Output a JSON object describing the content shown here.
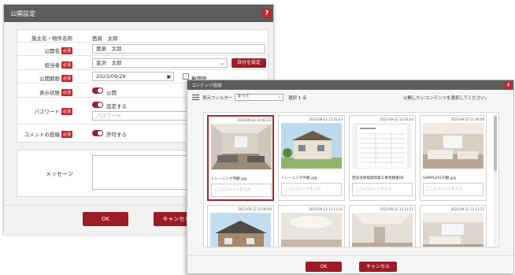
{
  "publish_dialog": {
    "title": "公開設定",
    "help_label": "?",
    "required_badge": "必須",
    "fields": {
      "builder_label": "施主名・物件名称",
      "builder_value": "茜泉　太郎",
      "public_name_label": "公開名",
      "public_name_value": "茜泉　太郎",
      "assignee_label": "担当者",
      "assignee_value": "金沢　太郎",
      "assign_self_button": "自分を設定",
      "period_label": "公開期限",
      "period_value": "2023/09/29",
      "indefinite_label": "無期限",
      "status_label": "表示状態",
      "status_value": "公開",
      "password_label": "パスワード",
      "password_toggle": "設定する",
      "password_placeholder": "パスワード",
      "comment_label": "コメントの投稿",
      "comment_toggle": "許可する",
      "message_label": "メッセージ"
    },
    "ok_button": "OK",
    "cancel_button": "キャンセル"
  },
  "content_dialog": {
    "title": "コンテンツ追加",
    "help_label": "?",
    "filter_label": "表示フィルター",
    "filter_value": "すべて",
    "selected_count": "選択 1 点",
    "instruction": "公開したいコンテンツを選択してください。",
    "comment_placeholder": "ここにコメントを入力",
    "cards": [
      {
        "timestamp": "2023-09-22 11:03:23",
        "filename": "トレーニング内観.jpg"
      },
      {
        "timestamp": "2023-09-22 11:03:23",
        "filename": "トレーニング外観.jpg"
      },
      {
        "timestamp": "2023-09-22 11:03:24",
        "filename": "西泉太郎様邸新築工事見積書06"
      },
      {
        "timestamp": "2023-09-22 11:06:08",
        "filename": "SAMPLE01内観.jpg"
      }
    ],
    "cards_row2": [
      {
        "timestamp": "2023-09-22 11:06:09"
      },
      {
        "timestamp": "2023-09-22 11:11:11"
      },
      {
        "timestamp": "2023-09-22 11:11:11"
      },
      {
        "timestamp": "2023-09-22 11:11:11"
      }
    ],
    "ok_button": "OK",
    "cancel_button": "キャンセル"
  },
  "colors": {
    "accent": "#9b1c26",
    "titlebar": "#5c5c5c",
    "required": "#c1272d"
  }
}
